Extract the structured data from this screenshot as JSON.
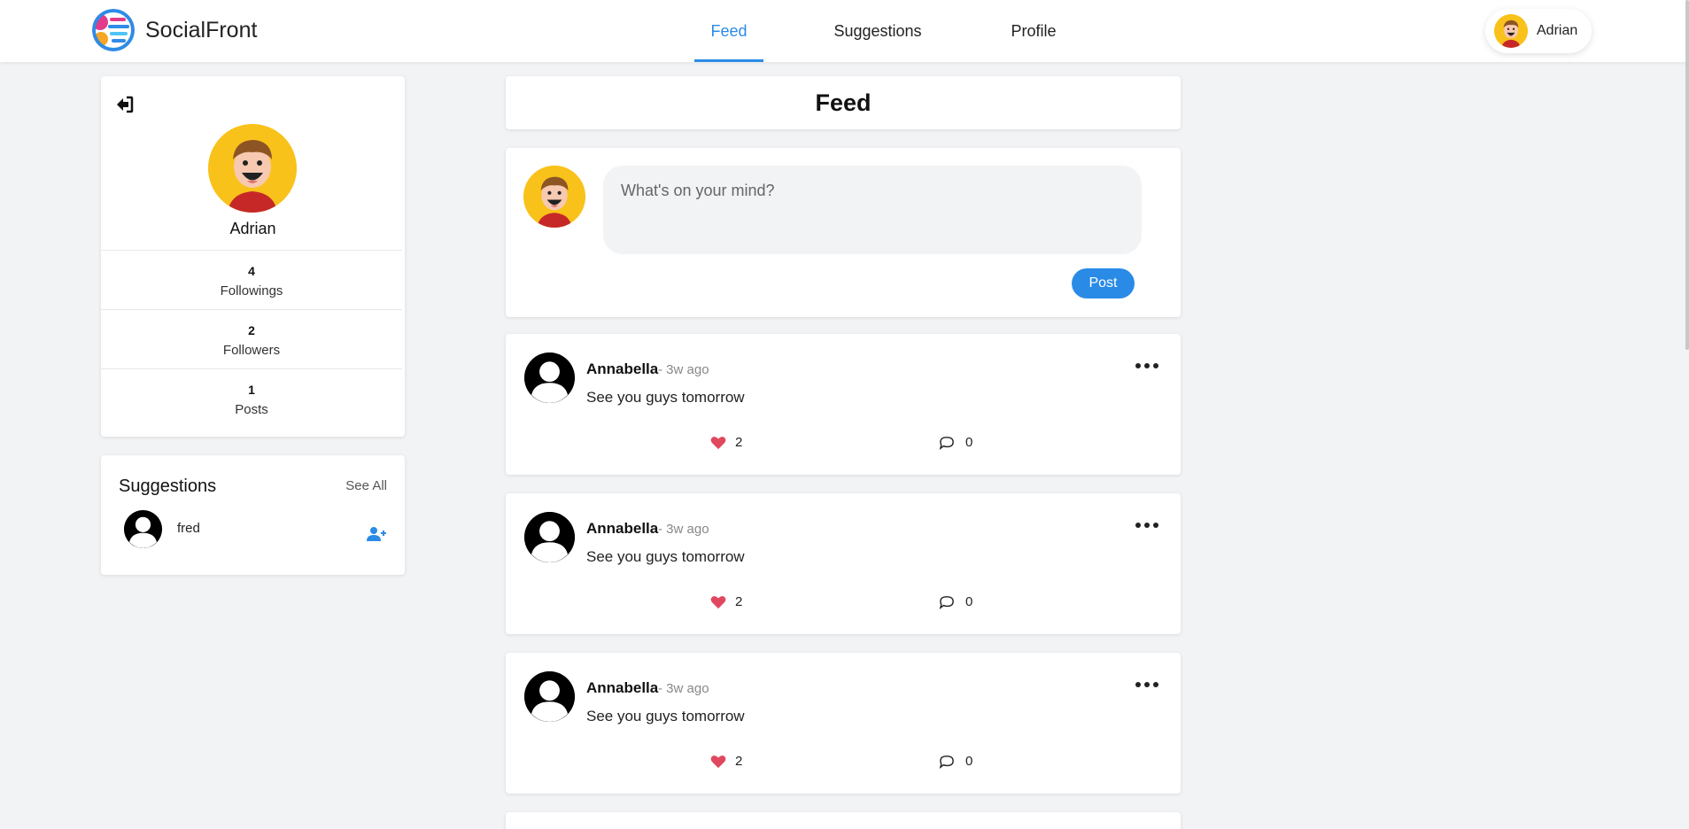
{
  "header": {
    "brand_name": "SocialFront",
    "nav": [
      "Feed",
      "Suggestions",
      "Profile"
    ],
    "active_tab": "Feed",
    "user_name": "Adrian"
  },
  "profile": {
    "name": "Adrian",
    "stats": [
      {
        "value": "4",
        "label": "Followings"
      },
      {
        "value": "2",
        "label": "Followers"
      },
      {
        "value": "1",
        "label": "Posts"
      }
    ]
  },
  "suggestions": {
    "title": "Suggestions",
    "see_all": "See All",
    "items": [
      {
        "name": "fred"
      }
    ]
  },
  "feed": {
    "title": "Feed",
    "composer_placeholder": "What's on your mind?",
    "post_button": "Post",
    "posts": [
      {
        "author": "Annabella",
        "time": "- 3w ago",
        "text": "See you guys tomorrow",
        "likes": "2",
        "comments": "0"
      },
      {
        "author": "Annabella",
        "time": "- 3w ago",
        "text": "See you guys tomorrow",
        "likes": "2",
        "comments": "0"
      },
      {
        "author": "Annabella",
        "time": "- 3w ago",
        "text": "See you guys tomorrow",
        "likes": "2",
        "comments": "0"
      }
    ]
  },
  "colors": {
    "accent": "#2a8be6",
    "like": "#e0485f",
    "avatar_bg": "#f9c21a",
    "background": "#f2f3f5"
  },
  "icons": {
    "logout": "logout-icon",
    "add_user": "user-plus-icon",
    "more": "more-horizontal-icon",
    "like": "heart-icon",
    "comment": "comment-icon"
  }
}
